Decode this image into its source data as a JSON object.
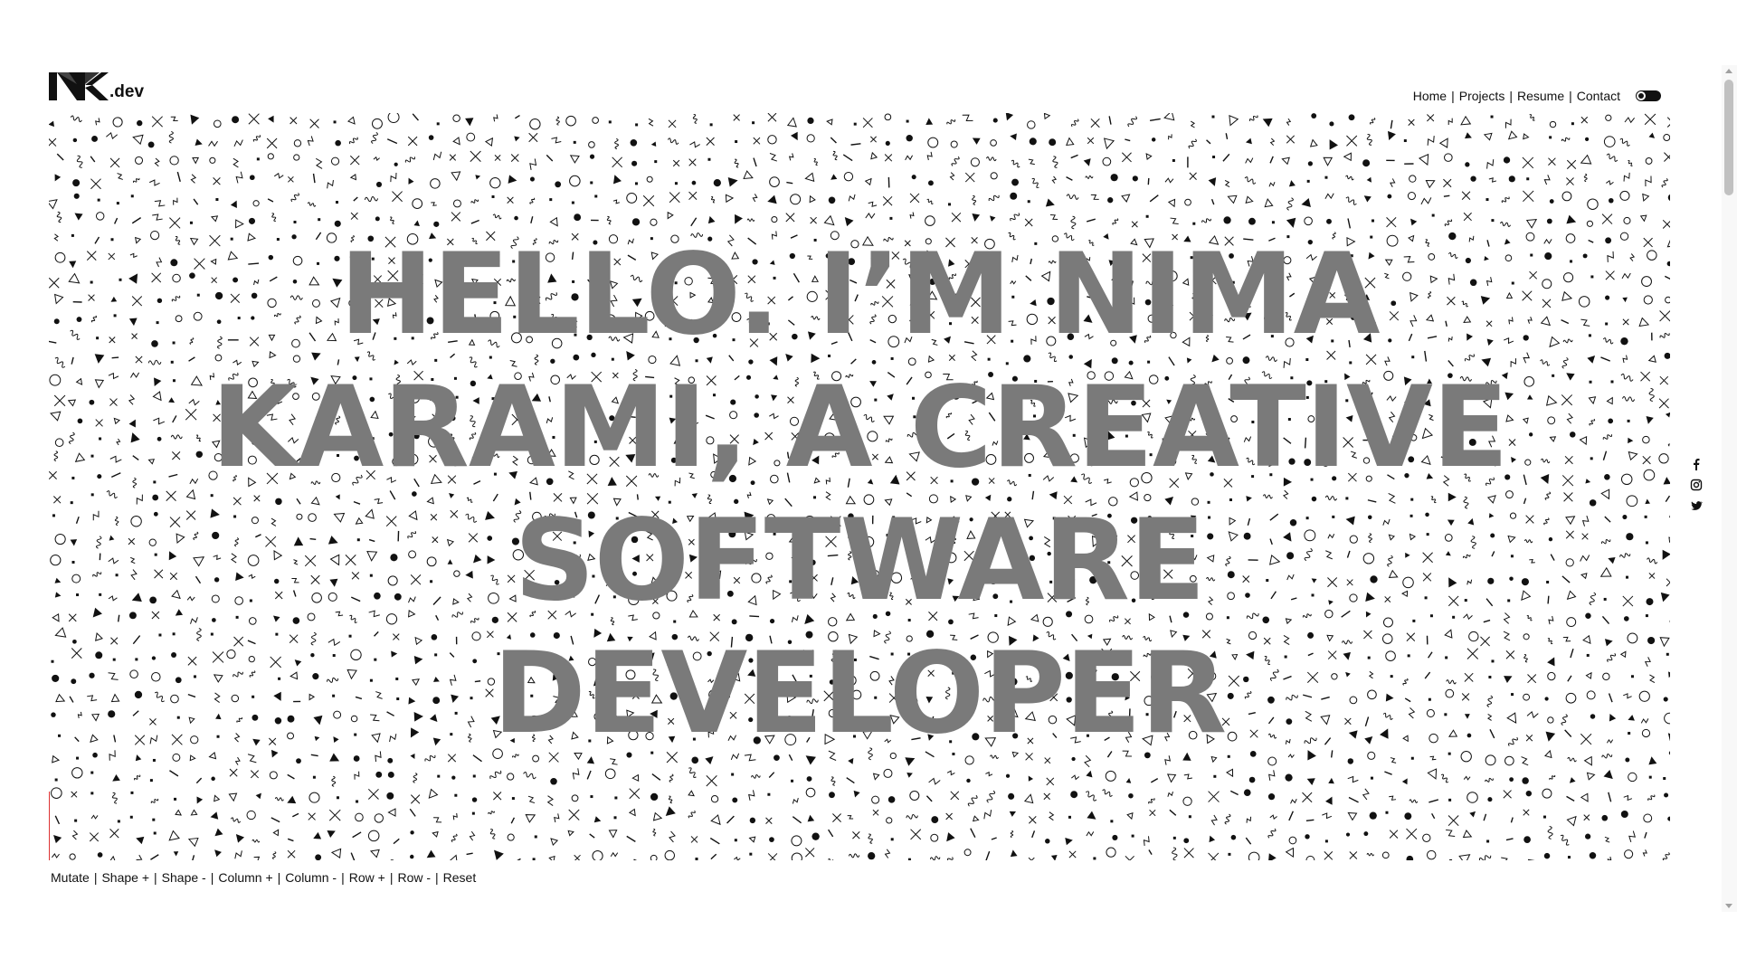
{
  "header": {
    "logo_text": ".dev",
    "logo_icon": "nk-monogram-icon",
    "nav": [
      {
        "label": "Home"
      },
      {
        "label": "Projects"
      },
      {
        "label": "Resume"
      },
      {
        "label": "Contact"
      }
    ],
    "theme_toggle_icon": "moon-icon"
  },
  "hero": {
    "headline_lines": [
      "HELLO. I’M NIMA",
      "KARAMI, A CREATIVE",
      "SOFTWARE",
      "DEVELOPER"
    ],
    "pattern": "memphis-shapes-pattern",
    "text_color": "#7a7a7a"
  },
  "controls": {
    "items": [
      {
        "label": "Mutate"
      },
      {
        "label": "Shape +"
      },
      {
        "label": "Shape -"
      },
      {
        "label": "Column +"
      },
      {
        "label": "Column -"
      },
      {
        "label": "Row +"
      },
      {
        "label": "Row -"
      },
      {
        "label": "Reset"
      }
    ]
  },
  "social": [
    {
      "icon": "facebook-icon"
    },
    {
      "icon": "instagram-icon"
    },
    {
      "icon": "twitter-icon"
    }
  ],
  "colors": {
    "accent_line": "#dd3333",
    "pattern_ink": "#111111",
    "background": "#ffffff"
  }
}
